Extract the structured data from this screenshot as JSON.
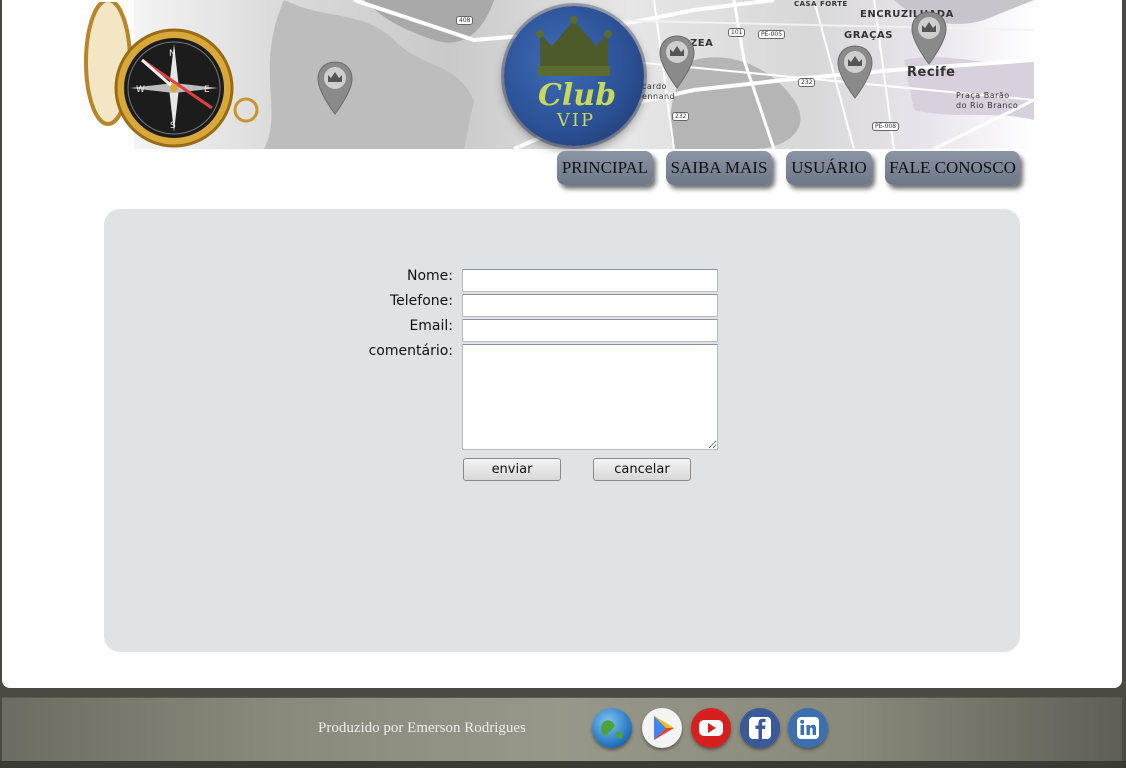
{
  "header": {
    "logo": {
      "line1": "Club",
      "line2": "VIP"
    },
    "map_labels": {
      "casa_forte": "CASA FORTE",
      "encruzilhada": "ENCRUZILHADA",
      "varzea": "VARZEA",
      "gracas": "GRAÇAS",
      "recife": "Recife",
      "praca": "Praça Barão",
      "praca2": "do Rio Branco",
      "cardo": "cardo",
      "ennand": "ennand",
      "road_408": "408",
      "road_101": "101",
      "road_pe005": "PE-005",
      "road_232a": "232",
      "road_232b": "232",
      "road_pe008": "PE-008"
    }
  },
  "nav": {
    "items": [
      {
        "label": "PRINCIPAL"
      },
      {
        "label": "SAIBA MAIS"
      },
      {
        "label": "USUÁRIO"
      },
      {
        "label": "FALE CONOSCO"
      }
    ]
  },
  "form": {
    "name_label": "Nome:",
    "phone_label": "Telefone:",
    "email_label": "Email:",
    "comment_label": "comentário:",
    "name_value": "",
    "phone_value": "",
    "email_value": "",
    "comment_value": "",
    "submit_label": "enviar",
    "cancel_label": "cancelar"
  },
  "footer": {
    "credit": "Produzido por Emerson Rodrigues",
    "social_icons": [
      "globe-icon",
      "google-play-icon",
      "youtube-icon",
      "facebook-icon",
      "linkedin-icon"
    ]
  },
  "colors": {
    "nav_button": "#7a8394",
    "panel_bg": "#e0e3e6",
    "logo_blue": "#2b4f93",
    "logo_green": "#c8d85a"
  }
}
